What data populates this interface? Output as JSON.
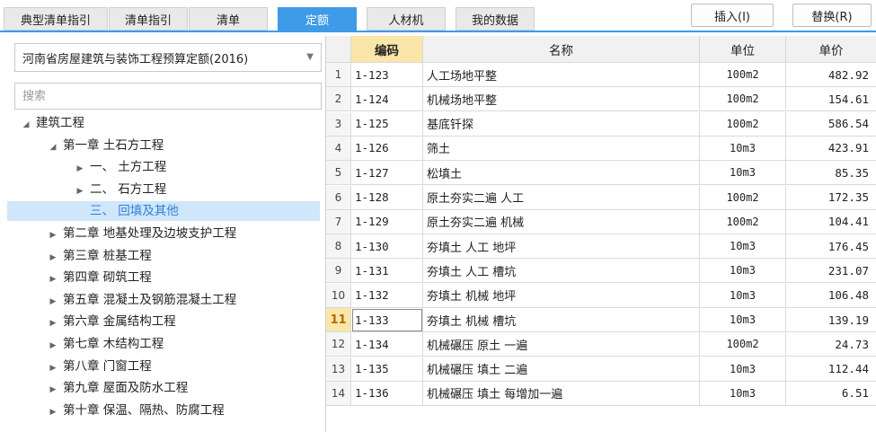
{
  "tabs": [
    {
      "label": "典型清单指引",
      "active": false
    },
    {
      "label": "清单指引",
      "active": false
    },
    {
      "label": "清单",
      "active": false
    },
    {
      "label": "定额",
      "active": true
    },
    {
      "label": "人材机",
      "active": false
    },
    {
      "label": "我的数据",
      "active": false
    }
  ],
  "buttons": {
    "insert": "插入(I)",
    "replace": "替换(R)"
  },
  "quota_select": {
    "value": "河南省房屋建筑与装饰工程预算定额(2016)"
  },
  "search": {
    "placeholder": "搜索",
    "value": ""
  },
  "tree": [
    {
      "label": "建筑工程",
      "level": 0,
      "toggle": "expanded",
      "selected": false
    },
    {
      "label": "第一章 土石方工程",
      "level": 1,
      "toggle": "expanded",
      "selected": false
    },
    {
      "label": "一、 土方工程",
      "level": 2,
      "toggle": "collapsed",
      "selected": false
    },
    {
      "label": "二、 石方工程",
      "level": 2,
      "toggle": "collapsed",
      "selected": false
    },
    {
      "label": "三、 回填及其他",
      "level": 2,
      "toggle": "none",
      "selected": true
    },
    {
      "label": "第二章 地基处理及边坡支护工程",
      "level": 1,
      "toggle": "collapsed",
      "selected": false
    },
    {
      "label": "第三章 桩基工程",
      "level": 1,
      "toggle": "collapsed",
      "selected": false
    },
    {
      "label": "第四章 砌筑工程",
      "level": 1,
      "toggle": "collapsed",
      "selected": false
    },
    {
      "label": "第五章 混凝土及钢筋混凝土工程",
      "level": 1,
      "toggle": "collapsed",
      "selected": false
    },
    {
      "label": "第六章 金属结构工程",
      "level": 1,
      "toggle": "collapsed",
      "selected": false
    },
    {
      "label": "第七章 木结构工程",
      "level": 1,
      "toggle": "collapsed",
      "selected": false
    },
    {
      "label": "第八章 门窗工程",
      "level": 1,
      "toggle": "collapsed",
      "selected": false
    },
    {
      "label": "第九章 屋面及防水工程",
      "level": 1,
      "toggle": "collapsed",
      "selected": false
    },
    {
      "label": "第十章 保温、隔热、防腐工程",
      "level": 1,
      "toggle": "collapsed",
      "selected": false
    }
  ],
  "table": {
    "headers": {
      "code": "编码",
      "name": "名称",
      "unit": "单位",
      "price": "单价"
    },
    "current_row": 11,
    "rows": [
      {
        "n": "1",
        "code": "1-123",
        "name": "人工场地平整",
        "unit": "100m2",
        "price": "482.92"
      },
      {
        "n": "2",
        "code": "1-124",
        "name": "机械场地平整",
        "unit": "100m2",
        "price": "154.61"
      },
      {
        "n": "3",
        "code": "1-125",
        "name": "基底钎探",
        "unit": "100m2",
        "price": "586.54"
      },
      {
        "n": "4",
        "code": "1-126",
        "name": "筛土",
        "unit": "10m3",
        "price": "423.91"
      },
      {
        "n": "5",
        "code": "1-127",
        "name": "松填土",
        "unit": "10m3",
        "price": "85.35"
      },
      {
        "n": "6",
        "code": "1-128",
        "name": "原土夯实二遍 人工",
        "unit": "100m2",
        "price": "172.35"
      },
      {
        "n": "7",
        "code": "1-129",
        "name": "原土夯实二遍 机械",
        "unit": "100m2",
        "price": "104.41"
      },
      {
        "n": "8",
        "code": "1-130",
        "name": "夯填土 人工 地坪",
        "unit": "10m3",
        "price": "176.45"
      },
      {
        "n": "9",
        "code": "1-131",
        "name": "夯填土 人工 槽坑",
        "unit": "10m3",
        "price": "231.07"
      },
      {
        "n": "10",
        "code": "1-132",
        "name": "夯填土 机械 地坪",
        "unit": "10m3",
        "price": "106.48"
      },
      {
        "n": "11",
        "code": "1-133",
        "name": "夯填土 机械 槽坑",
        "unit": "10m3",
        "price": "139.19"
      },
      {
        "n": "12",
        "code": "1-134",
        "name": "机械碾压 原土 一遍",
        "unit": "100m2",
        "price": "24.73"
      },
      {
        "n": "13",
        "code": "1-135",
        "name": "机械碾压 填土 二遍",
        "unit": "10m3",
        "price": "112.44"
      },
      {
        "n": "14",
        "code": "1-136",
        "name": "机械碾压 填土 每增加一遍",
        "unit": "10m3",
        "price": "6.51"
      }
    ]
  }
}
